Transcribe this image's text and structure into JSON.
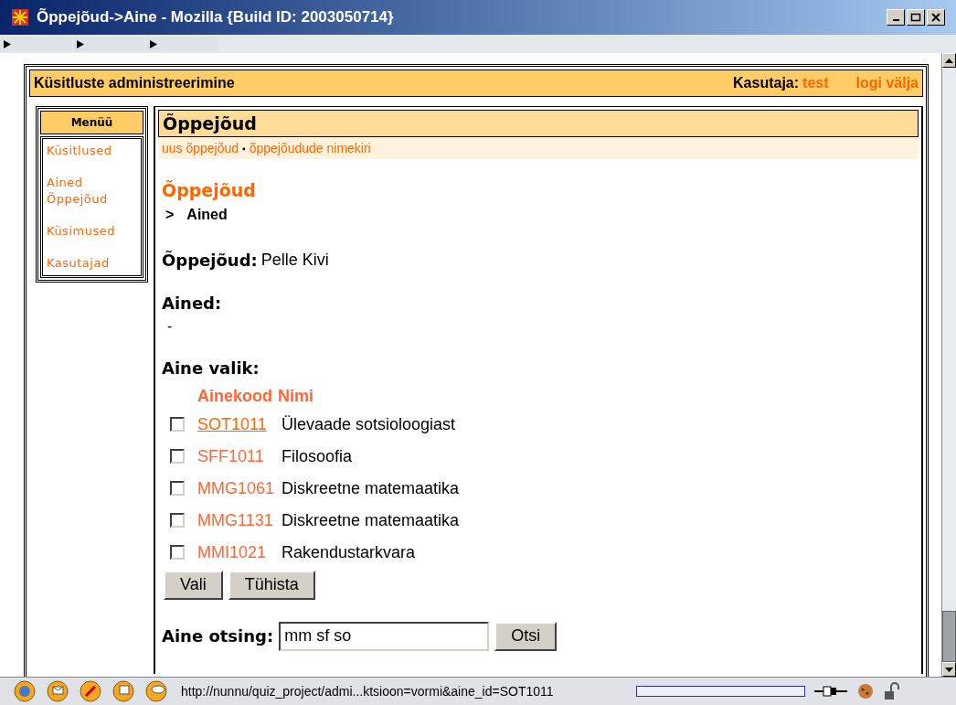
{
  "window": {
    "title": "Õppejõud->Aine - Mozilla {Build ID: 2003050714}"
  },
  "header": {
    "title": "Küsitluste administreerimine",
    "user_label": "Kasutaja:",
    "user_name": "test",
    "logout": "logi välja"
  },
  "menu": {
    "title": "Menüü",
    "items": [
      "Küsitlused",
      "Ained",
      "Õppejõud",
      "Küsimused",
      "Kasutajad"
    ]
  },
  "panel": {
    "title": "Õppejõud",
    "links": [
      "uus õppejõud",
      "õppejõudude nimekiri"
    ],
    "separator": "▪"
  },
  "breadcrumb": {
    "title": "Õppejõud",
    "arrow": ">",
    "current": "Ained"
  },
  "teacher": {
    "label": "Õppejõud:",
    "value": "Pelle Kivi"
  },
  "courses": {
    "label": "Ained:",
    "value": "-"
  },
  "selection": {
    "label": "Aine valik:",
    "columns": [
      "Ainekood",
      "Nimi"
    ],
    "rows": [
      {
        "code": "SOT1011",
        "name": "Ülevaade sotsioloogiast",
        "checked": false,
        "hovered": true
      },
      {
        "code": "SFF1011",
        "name": "Filosoofia",
        "checked": false,
        "hovered": false
      },
      {
        "code": "MMG1061",
        "name": "Diskreetne matemaatika",
        "checked": false,
        "hovered": false
      },
      {
        "code": "MMG1131",
        "name": "Diskreetne matemaatika",
        "checked": false,
        "hovered": false
      },
      {
        "code": "MMI1021",
        "name": "Rakendustarkvara",
        "checked": false,
        "hovered": false
      }
    ],
    "buttons": [
      "Vali",
      "Tühista"
    ]
  },
  "search": {
    "label": "Aine otsing:",
    "value": "mm sf so",
    "button": "Otsi"
  },
  "status_bar": {
    "url": "http://nunnu/quiz_project/admi...ktsioon=vormi&aine_id=SOT1011"
  }
}
